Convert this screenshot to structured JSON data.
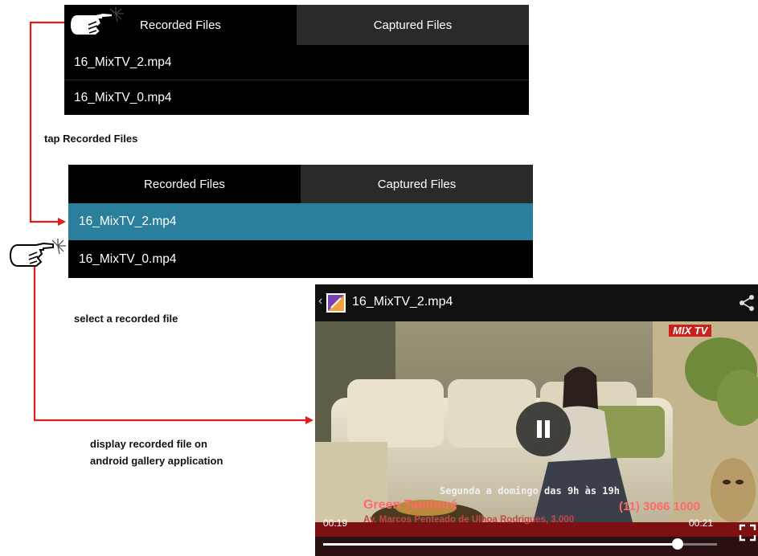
{
  "tabs": {
    "recorded": "Recorded Files",
    "captured": "Captured Files"
  },
  "files": [
    "16_MixTV_2.mp4",
    "16_MixTV_0.mp4"
  ],
  "instructions": {
    "step1": "tap Recorded Files",
    "step2": "select a recorded file",
    "step3_line1": "display recorded file on",
    "step3_line2": "android gallery application"
  },
  "video": {
    "title": "16_MixTV_2.mp4",
    "watermark": "MIX TV",
    "ticker_top": "Segunda a domingo das 9h às 19h",
    "ticker_name": "Green Tamboré",
    "ticker_phone": "(11) 3066 1000",
    "ticker_address": "Av. Marcos Penteado de Ulhoa Rodrigues, 3.000",
    "elapsed": "00:19",
    "duration": "00:21",
    "progress": 0.9
  },
  "colors": {
    "accent": "#2a7f9c",
    "connector": "#e31b1b"
  }
}
